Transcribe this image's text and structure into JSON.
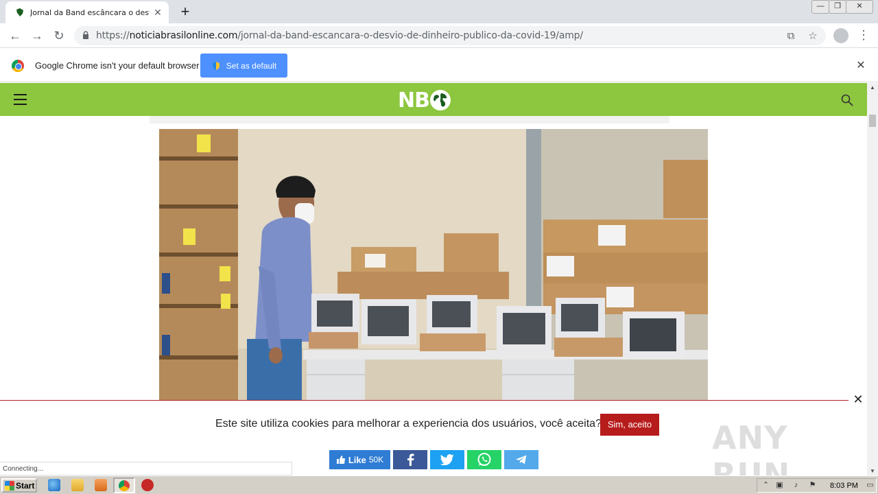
{
  "browser": {
    "tab_title": "Jornal da Band escâncara o desvio d",
    "new_tab": "+",
    "window_controls": {
      "minimize": "—",
      "restore": "❐",
      "close": "✕"
    },
    "url_prefix": "https://",
    "url_domain": "noticiabrasilonline.com",
    "url_path": "/jornal-da-band-escancara-o-desvio-de-dinheiro-publico-da-covid-19/amp/",
    "status_text": "Connecting..."
  },
  "infobar": {
    "message": "Google Chrome isn't your default browser",
    "button": "Set as default"
  },
  "site": {
    "logo_text": "NB",
    "header_color": "#8dc63f"
  },
  "cookie": {
    "text": "Este site utiliza cookies para melhorar a experiencia dos usuários, você aceita?",
    "accept": "Sim, aceito"
  },
  "share": {
    "like_label": "Like",
    "like_count": "50K"
  },
  "watermark": "ANY  RUN",
  "taskbar": {
    "start": "Start",
    "clock": "8:03 PM"
  }
}
